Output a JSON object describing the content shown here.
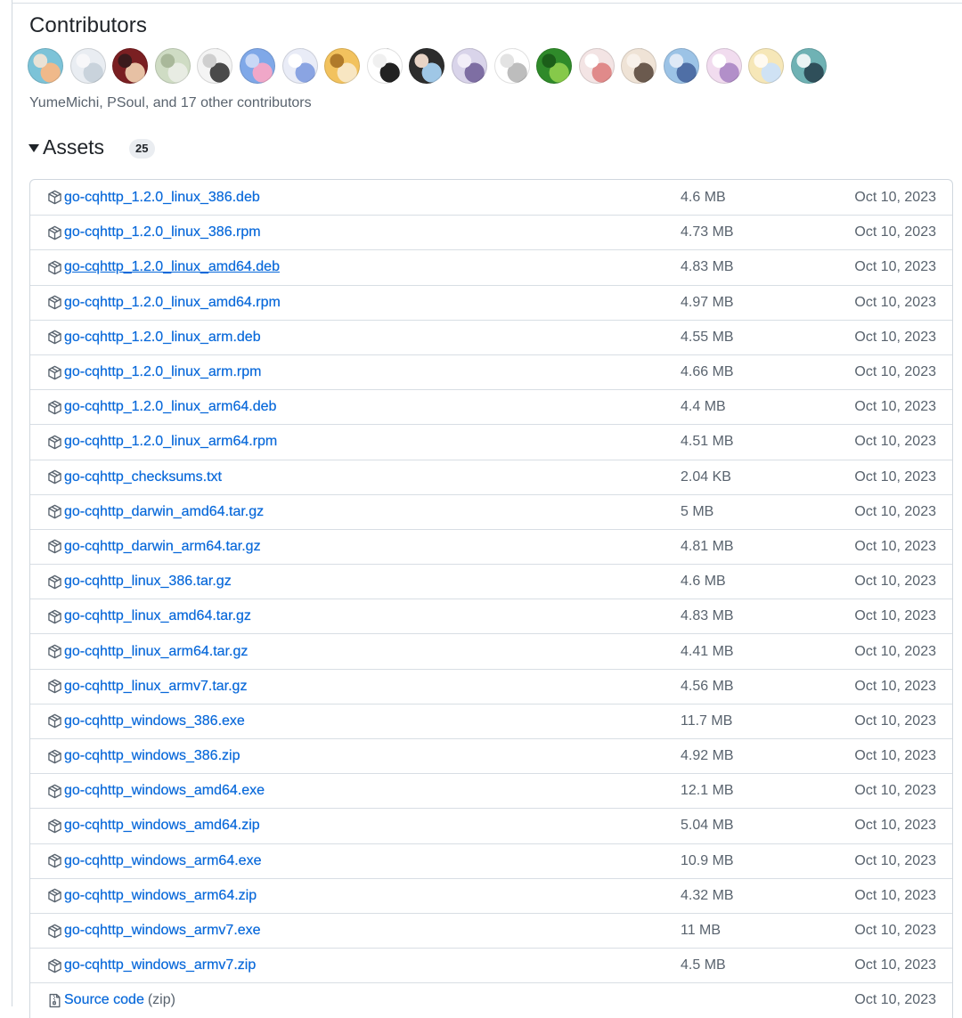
{
  "contributors": {
    "title": "Contributors",
    "summary": "YumeMichi, PSoul, and 17 other contributors",
    "avatars": [
      {
        "name": "avatar-1",
        "colors": [
          "#7cc3d8",
          "#f0b98a",
          "#e9e2d6"
        ]
      },
      {
        "name": "avatar-2",
        "colors": [
          "#e9edf2",
          "#c9d3dc",
          "#f7f7f9"
        ]
      },
      {
        "name": "avatar-3",
        "colors": [
          "#7a1f22",
          "#e7c1a4",
          "#3a1a1c"
        ]
      },
      {
        "name": "avatar-4",
        "colors": [
          "#cfdcc4",
          "#e8ece3",
          "#a9b89a"
        ]
      },
      {
        "name": "avatar-5",
        "colors": [
          "#f4f4f4",
          "#4a4a4a",
          "#cfcfcf"
        ]
      },
      {
        "name": "avatar-6",
        "colors": [
          "#7fa8e8",
          "#f0a7c8",
          "#c8d8f6"
        ]
      },
      {
        "name": "avatar-7",
        "colors": [
          "#e9ecf7",
          "#8aa4e2",
          "#ffffff"
        ]
      },
      {
        "name": "avatar-8",
        "colors": [
          "#f2c25e",
          "#f8e6c2",
          "#b07a2a"
        ]
      },
      {
        "name": "avatar-9",
        "colors": [
          "#ffffff",
          "#222222",
          "#f0f0f0"
        ]
      },
      {
        "name": "avatar-10",
        "colors": [
          "#2d2d2d",
          "#9fc7e6",
          "#e8d4c6"
        ]
      },
      {
        "name": "avatar-11",
        "colors": [
          "#d9d4ea",
          "#7e6ea3",
          "#f2eef8"
        ]
      },
      {
        "name": "avatar-12",
        "colors": [
          "#ffffff",
          "#bdbdbd",
          "#e3e3e3"
        ]
      },
      {
        "name": "avatar-13",
        "colors": [
          "#2f8a2a",
          "#86c94a",
          "#1b5e19"
        ]
      },
      {
        "name": "avatar-14",
        "colors": [
          "#f3e4e4",
          "#e08a8a",
          "#ffffff"
        ]
      },
      {
        "name": "avatar-15",
        "colors": [
          "#efe3d6",
          "#6b5a4e",
          "#f8f1ea"
        ]
      },
      {
        "name": "avatar-16",
        "colors": [
          "#9cc3e6",
          "#4f6fa6",
          "#dfe9f6"
        ]
      },
      {
        "name": "avatar-17",
        "colors": [
          "#f1dcef",
          "#b28fc9",
          "#ffffff"
        ]
      },
      {
        "name": "avatar-18",
        "colors": [
          "#f6e7b8",
          "#cfe2f4",
          "#fffaf0"
        ]
      },
      {
        "name": "avatar-19",
        "colors": [
          "#6fb2b4",
          "#2f4f5a",
          "#eaf4f4"
        ]
      }
    ]
  },
  "assets": {
    "title": "Assets",
    "count": "25",
    "link_color": "#0969da",
    "rows": [
      {
        "name": "go-cqhttp_1.2.0_linux_386.deb",
        "size": "4.6 MB",
        "date": "Oct 10, 2023",
        "icon": "package-icon"
      },
      {
        "name": "go-cqhttp_1.2.0_linux_386.rpm",
        "size": "4.73 MB",
        "date": "Oct 10, 2023",
        "icon": "package-icon"
      },
      {
        "name": "go-cqhttp_1.2.0_linux_amd64.deb",
        "size": "4.83 MB",
        "date": "Oct 10, 2023",
        "icon": "package-icon",
        "hovered": true
      },
      {
        "name": "go-cqhttp_1.2.0_linux_amd64.rpm",
        "size": "4.97 MB",
        "date": "Oct 10, 2023",
        "icon": "package-icon"
      },
      {
        "name": "go-cqhttp_1.2.0_linux_arm.deb",
        "size": "4.55 MB",
        "date": "Oct 10, 2023",
        "icon": "package-icon"
      },
      {
        "name": "go-cqhttp_1.2.0_linux_arm.rpm",
        "size": "4.66 MB",
        "date": "Oct 10, 2023",
        "icon": "package-icon"
      },
      {
        "name": "go-cqhttp_1.2.0_linux_arm64.deb",
        "size": "4.4 MB",
        "date": "Oct 10, 2023",
        "icon": "package-icon"
      },
      {
        "name": "go-cqhttp_1.2.0_linux_arm64.rpm",
        "size": "4.51 MB",
        "date": "Oct 10, 2023",
        "icon": "package-icon"
      },
      {
        "name": "go-cqhttp_checksums.txt",
        "size": "2.04 KB",
        "date": "Oct 10, 2023",
        "icon": "package-icon"
      },
      {
        "name": "go-cqhttp_darwin_amd64.tar.gz",
        "size": "5 MB",
        "date": "Oct 10, 2023",
        "icon": "package-icon"
      },
      {
        "name": "go-cqhttp_darwin_arm64.tar.gz",
        "size": "4.81 MB",
        "date": "Oct 10, 2023",
        "icon": "package-icon"
      },
      {
        "name": "go-cqhttp_linux_386.tar.gz",
        "size": "4.6 MB",
        "date": "Oct 10, 2023",
        "icon": "package-icon"
      },
      {
        "name": "go-cqhttp_linux_amd64.tar.gz",
        "size": "4.83 MB",
        "date": "Oct 10, 2023",
        "icon": "package-icon"
      },
      {
        "name": "go-cqhttp_linux_arm64.tar.gz",
        "size": "4.41 MB",
        "date": "Oct 10, 2023",
        "icon": "package-icon"
      },
      {
        "name": "go-cqhttp_linux_armv7.tar.gz",
        "size": "4.56 MB",
        "date": "Oct 10, 2023",
        "icon": "package-icon"
      },
      {
        "name": "go-cqhttp_windows_386.exe",
        "size": "11.7 MB",
        "date": "Oct 10, 2023",
        "icon": "package-icon"
      },
      {
        "name": "go-cqhttp_windows_386.zip",
        "size": "4.92 MB",
        "date": "Oct 10, 2023",
        "icon": "package-icon"
      },
      {
        "name": "go-cqhttp_windows_amd64.exe",
        "size": "12.1 MB",
        "date": "Oct 10, 2023",
        "icon": "package-icon"
      },
      {
        "name": "go-cqhttp_windows_amd64.zip",
        "size": "5.04 MB",
        "date": "Oct 10, 2023",
        "icon": "package-icon"
      },
      {
        "name": "go-cqhttp_windows_arm64.exe",
        "size": "10.9 MB",
        "date": "Oct 10, 2023",
        "icon": "package-icon"
      },
      {
        "name": "go-cqhttp_windows_arm64.zip",
        "size": "4.32 MB",
        "date": "Oct 10, 2023",
        "icon": "package-icon"
      },
      {
        "name": "go-cqhttp_windows_armv7.exe",
        "size": "11 MB",
        "date": "Oct 10, 2023",
        "icon": "package-icon"
      },
      {
        "name": "go-cqhttp_windows_armv7.zip",
        "size": "4.5 MB",
        "date": "Oct 10, 2023",
        "icon": "package-icon"
      },
      {
        "name": "Source code",
        "suffix": "(zip)",
        "size": "",
        "date": "Oct 10, 2023",
        "icon": "file-zip-icon"
      }
    ]
  }
}
